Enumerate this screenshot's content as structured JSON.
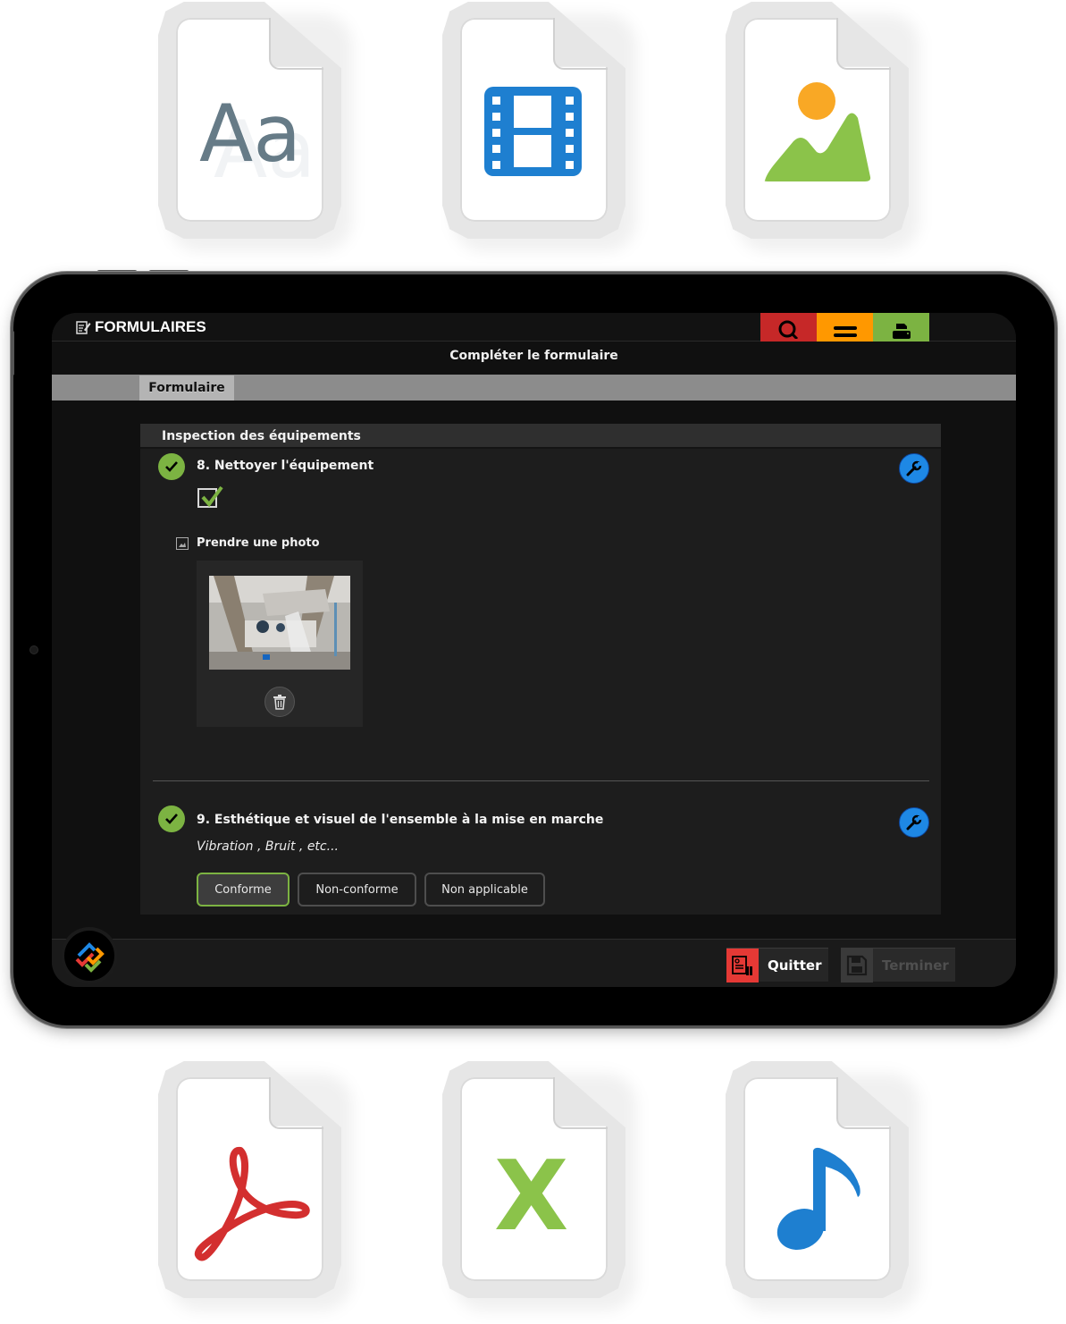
{
  "file_icons": {
    "top": [
      {
        "type": "text",
        "glyph_text": "Aa"
      },
      {
        "type": "video"
      },
      {
        "type": "image"
      }
    ],
    "bottom": [
      {
        "type": "pdf"
      },
      {
        "type": "excel",
        "glyph_text": "X"
      },
      {
        "type": "audio"
      }
    ]
  },
  "app": {
    "title": "FORMULAIRES",
    "page_heading": "Compléter le formulaire",
    "top_actions": [
      {
        "icon": "search-icon",
        "color": "#c62828"
      },
      {
        "icon": "menu-icon",
        "color": "#ff9800"
      },
      {
        "icon": "print-icon",
        "color": "#7cb342"
      }
    ]
  },
  "tabs": [
    {
      "label": "Formulaire",
      "active": true
    }
  ],
  "form": {
    "section_title": "Inspection des équipements",
    "questions": [
      {
        "title": "8. Nettoyer l'équipement",
        "status": "complete",
        "checkbox_checked": true,
        "photo_label": "Prendre une photo",
        "has_photo": true
      },
      {
        "title": "9. Esthétique et visuel de l'ensemble à la mise en marche",
        "status": "complete",
        "subtitle": "Vibration , Bruit , etc...",
        "options": [
          {
            "label": "Conforme",
            "selected": true
          },
          {
            "label": "Non-conforme",
            "selected": false
          },
          {
            "label": "Non applicable",
            "selected": false
          }
        ]
      }
    ]
  },
  "footer": {
    "quit_label": "Quitter",
    "finish_label": "Terminer",
    "finish_enabled": false
  },
  "colors": {
    "accent_green": "#7cb342",
    "accent_blue": "#1e88e5",
    "accent_red": "#e53935",
    "accent_orange": "#ff9800"
  }
}
